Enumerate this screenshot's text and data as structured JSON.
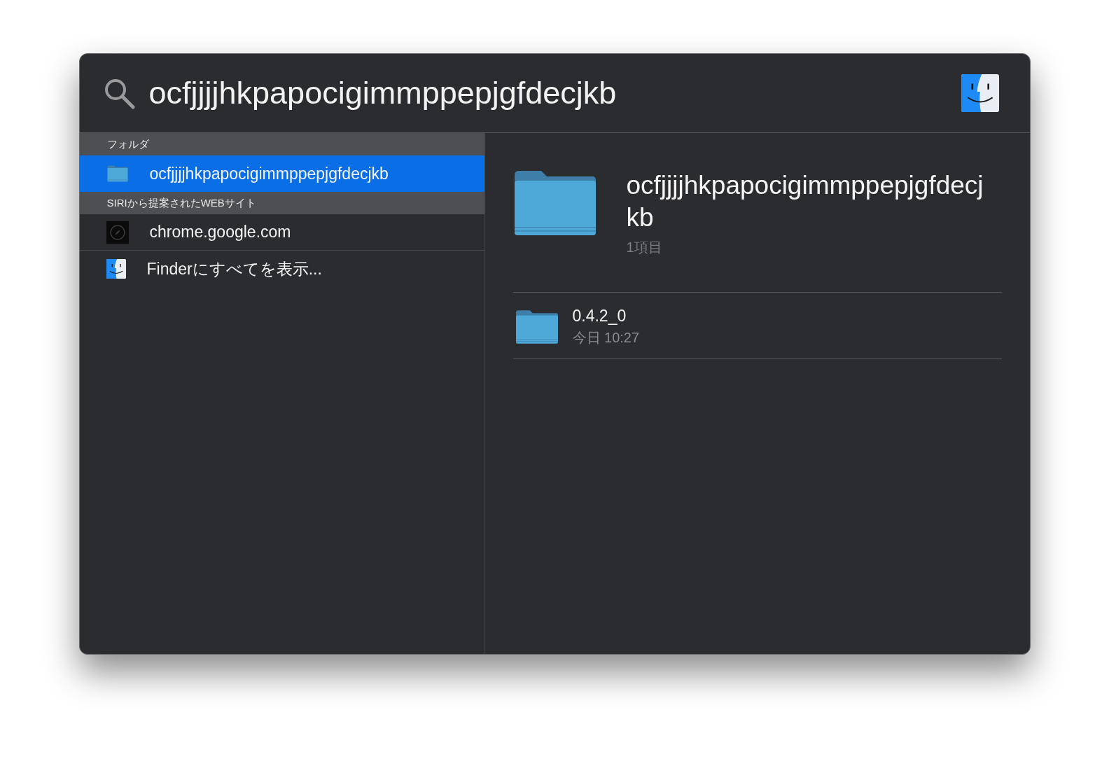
{
  "search": {
    "value": "ocfjjjjhkpapocigimmppepjgfdecjkb"
  },
  "sections": [
    {
      "header": "フォルダ",
      "items": [
        {
          "kind": "folder",
          "label": "ocfjjjjhkpapocigimmppepjgfdecjkb",
          "selected": true
        }
      ]
    },
    {
      "header": "SIRIから提案されたWEBサイト",
      "items": [
        {
          "kind": "web",
          "label": "chrome.google.com",
          "selected": false
        }
      ]
    }
  ],
  "show_all": {
    "kind": "finder",
    "label": "Finderにすべてを表示...",
    "selected": false
  },
  "preview": {
    "title": "ocfjjjjhkpapocigimmppepjgfdecjkb",
    "subtitle": "1項目",
    "contents": [
      {
        "name": "0.4.2_0",
        "date": "今日 10:27"
      }
    ]
  }
}
